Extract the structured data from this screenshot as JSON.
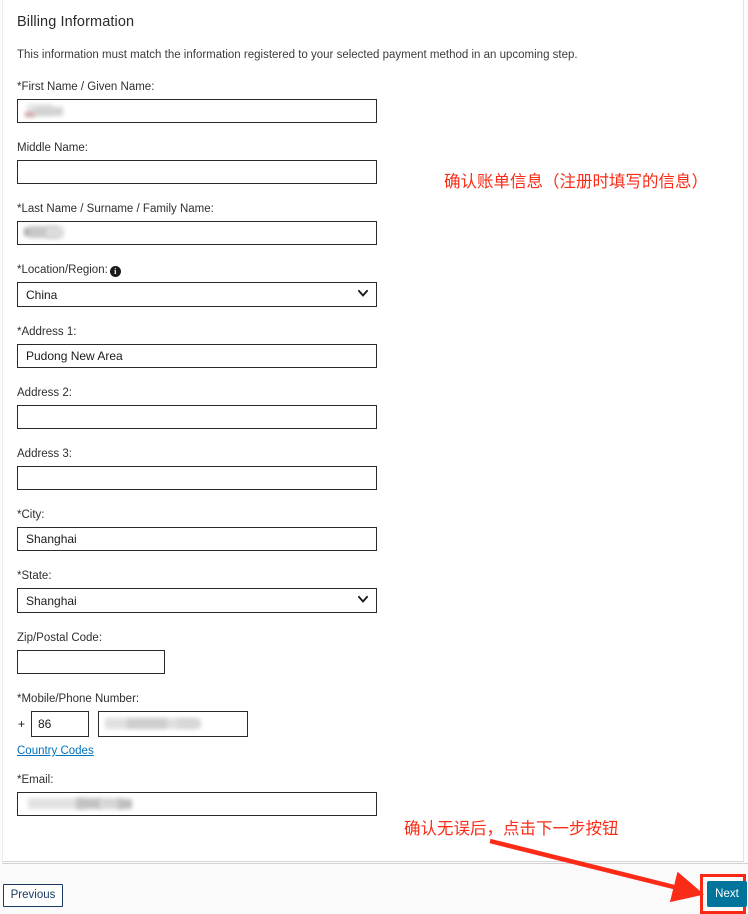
{
  "page": {
    "section_title": "Billing Information",
    "section_description": "This information must match the information registered to your selected payment method in an upcoming step."
  },
  "form": {
    "fields": [
      {
        "label": "*First Name / Given Name:",
        "value": "",
        "redacted": true,
        "type": "text"
      },
      {
        "label": "Middle Name:",
        "value": "",
        "redacted": false,
        "type": "text"
      },
      {
        "label": "*Last Name / Surname / Family Name:",
        "value": "",
        "redacted": true,
        "type": "text"
      },
      {
        "label": "*Location/Region:",
        "value": "China",
        "type": "select",
        "has_info_icon": true
      },
      {
        "label": "*Address 1:",
        "value": "Pudong New Area",
        "redacted": false,
        "type": "text"
      },
      {
        "label": "Address 2:",
        "value": "",
        "redacted": false,
        "type": "text"
      },
      {
        "label": "Address 3:",
        "value": "",
        "redacted": false,
        "type": "text"
      },
      {
        "label": "*City:",
        "value": "Shanghai",
        "redacted": false,
        "type": "text"
      },
      {
        "label": "*State:",
        "value": "Shanghai",
        "type": "select"
      },
      {
        "label": "Zip/Postal Code:",
        "value": "",
        "redacted": false,
        "type": "text-narrow"
      }
    ],
    "labels": {
      "first_name": "*First Name / Given Name:",
      "middle_name": "Middle Name:",
      "last_name": "*Last Name / Surname / Family Name:",
      "location_region": "*Location/Region:",
      "address1": "*Address 1:",
      "address2": "Address 2:",
      "address3": "Address 3:",
      "city": "*City:",
      "state": "*State:",
      "zip": "Zip/Postal Code:",
      "phone": "*Mobile/Phone Number:",
      "email": "*Email:"
    },
    "values": {
      "first_name": "",
      "middle_name": "",
      "last_name": "",
      "location_region": "China",
      "address1": "Pudong New Area",
      "address2": "",
      "address3": "",
      "city": "Shanghai",
      "state": "Shanghai",
      "zip": "",
      "phone_plus": "+",
      "phone_country_code": "86",
      "phone_number": "",
      "email": ""
    },
    "country_codes_link": "Country Codes",
    "location_options": [
      "China"
    ],
    "state_options": [
      "Shanghai"
    ]
  },
  "footer": {
    "previous_label": "Previous",
    "next_label": "Next"
  },
  "annotations": [
    {
      "id": "anno-1",
      "text": "确认账单信息（注册时填写的信息）"
    },
    {
      "id": "anno-2",
      "text": "确认无误后，点击下一步按钮"
    }
  ],
  "colors": {
    "annotation_red": "#fa2c18",
    "next_button": "#00749a",
    "previous_border": "#1b3a63",
    "link_blue": "#0071bb",
    "highlight_box": "#fa2916"
  }
}
